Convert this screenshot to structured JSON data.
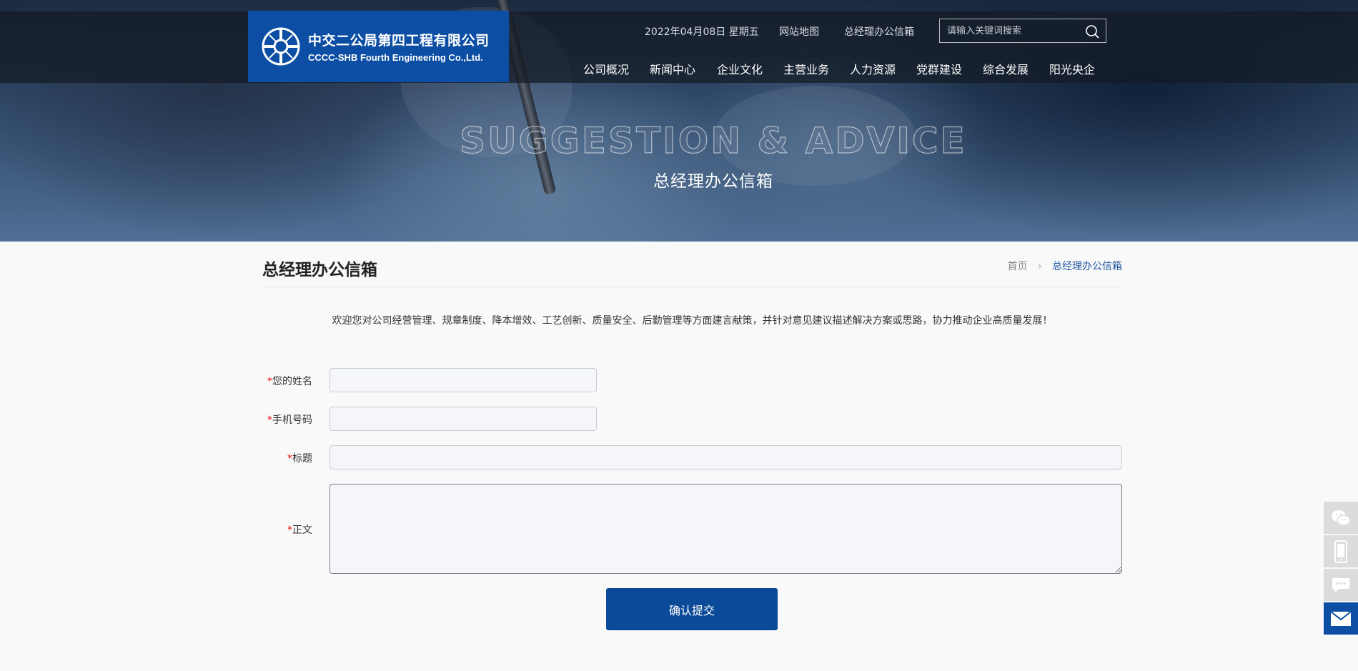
{
  "header": {
    "logo": {
      "name_cn": "中交二公局第四工程有限公司",
      "name_en": "CCCC-SHB Fourth Engineering Co.,Ltd."
    },
    "date": "2022年04月08日 星期五",
    "links": [
      "网站地图",
      "总经理办公信箱"
    ],
    "search": {
      "placeholder": "请输入关键词搜索",
      "icon": "search-icon"
    },
    "nav": [
      "公司概况",
      "新闻中心",
      "企业文化",
      "主营业务",
      "人力资源",
      "党群建设",
      "综合发展",
      "阳光央企"
    ]
  },
  "banner": {
    "title_en": "SUGGESTION & ADVICE",
    "title_cn": "总经理办公信箱"
  },
  "page": {
    "title": "总经理办公信箱",
    "breadcrumb": {
      "home": "首页",
      "separator": "›",
      "current": "总经理办公信箱"
    },
    "intro": "欢迎您对公司经营管理、规章制度、降本增效、工艺创新、质量安全、后勤管理等方面建言献策，并针对意见建议描述解决方案或思路，协力推动企业高质量发展！"
  },
  "form": {
    "required_mark": "*",
    "name_label": "您的姓名",
    "phone_label": "手机号码",
    "subject_label": "标题",
    "body_label": "正文",
    "name_value": "",
    "phone_value": "",
    "subject_value": "",
    "body_value": "",
    "submit_label": "确认提交"
  },
  "side_float": [
    "wechat-icon",
    "mobile-icon",
    "message-icon",
    "mail-icon"
  ],
  "colors": {
    "brand_blue": "#0b4ea3",
    "submit_blue": "#0b4a98",
    "required_red": "#ee0000",
    "breadcrumb_active": "#1e56a0"
  }
}
